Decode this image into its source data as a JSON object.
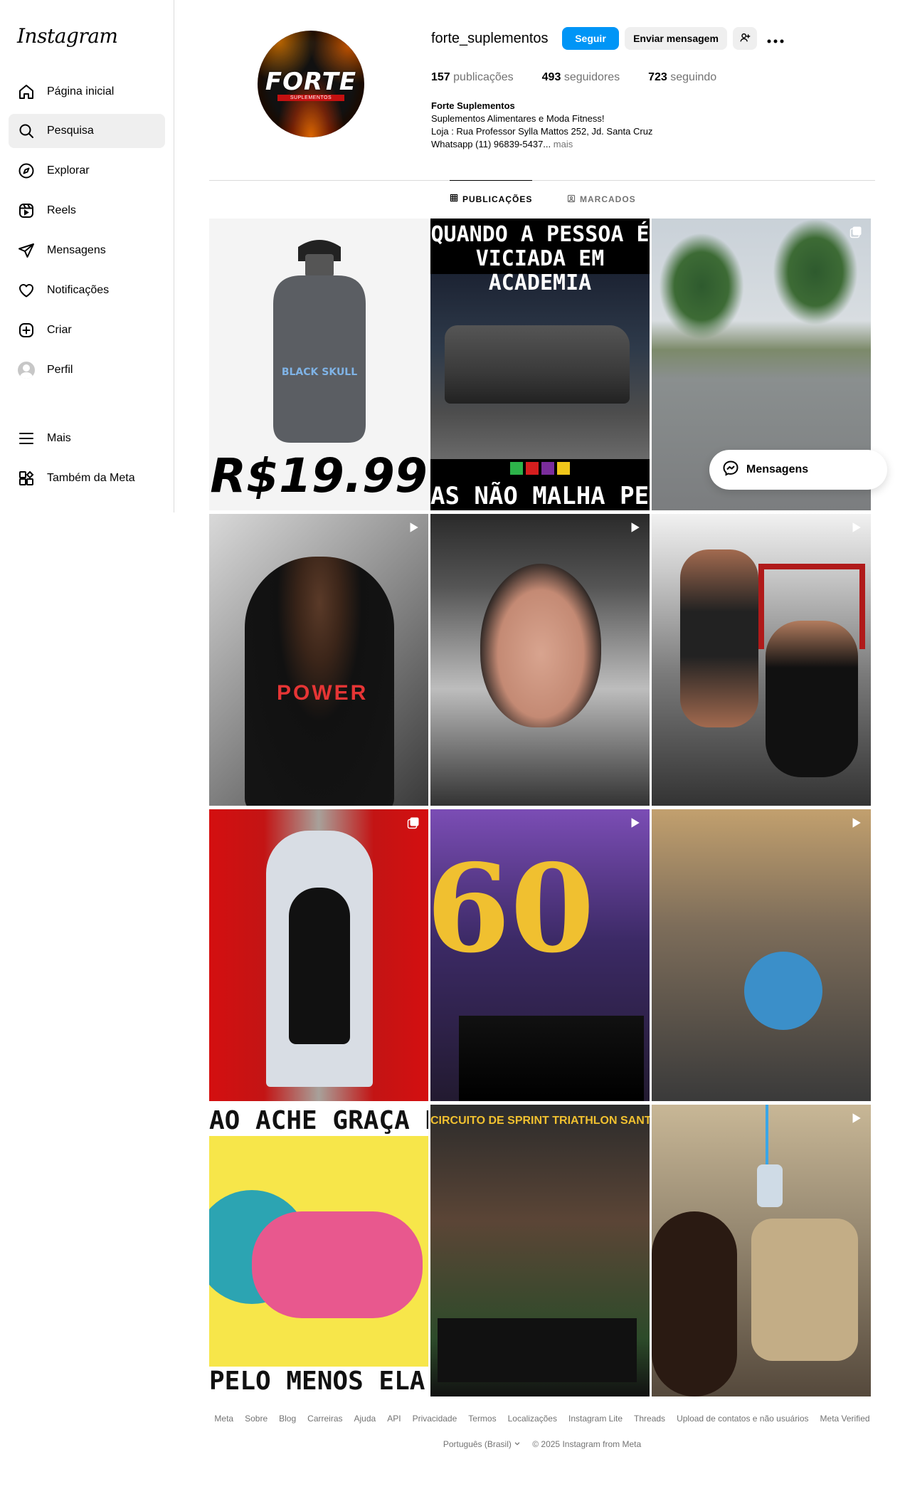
{
  "app": {
    "logo": "Instagram"
  },
  "sidebar": {
    "items": [
      {
        "label": "Página inicial",
        "icon": "home-icon"
      },
      {
        "label": "Pesquisa",
        "icon": "search-icon",
        "active": true
      },
      {
        "label": "Explorar",
        "icon": "compass-icon"
      },
      {
        "label": "Reels",
        "icon": "reels-icon"
      },
      {
        "label": "Mensagens",
        "icon": "send-icon"
      },
      {
        "label": "Notificações",
        "icon": "heart-icon"
      },
      {
        "label": "Criar",
        "icon": "plus-square-icon"
      },
      {
        "label": "Perfil",
        "icon": "avatar"
      },
      {
        "label": "Mais",
        "icon": "menu-icon"
      },
      {
        "label": "Também da Meta",
        "icon": "grid-icon"
      }
    ]
  },
  "profile": {
    "username": "forte_suplementos",
    "picture_brand": "FORTE",
    "picture_subtitle": "SUPLEMENTOS",
    "follow_label": "Seguir",
    "message_label": "Enviar mensagem",
    "stats": {
      "posts_count": "157",
      "posts_label": "publicações",
      "followers_count": "493",
      "followers_label": "seguidores",
      "following_count": "723",
      "following_label": "seguindo"
    },
    "bio": {
      "name": "Forte Suplementos",
      "line1": "Suplementos Alimentares e Moda Fitness!",
      "line2": "Loja : Rua Professor Sylla Mattos 252, Jd. Santa Cruz",
      "line3": "Whatsapp (11) 96839-5437...",
      "more": "mais"
    }
  },
  "tabs": [
    {
      "label": "PUBLICAÇÕES",
      "active": true,
      "icon": "grid-icon"
    },
    {
      "label": "MARCADOS",
      "active": false,
      "icon": "tag-icon"
    }
  ],
  "posts": {
    "p1": {
      "price": "R$19.99",
      "bottle_text": "BLACK SKULL"
    },
    "p2": {
      "top": "QUANDO A PESSOA É VICIADA EM ACADEMIA",
      "bottom": "AS NÃO MALHA PERN"
    },
    "p4": {
      "shirt_text": "POWER"
    },
    "p8": {
      "number": "60"
    },
    "p10": {
      "top": "AO ACHE GRAÇA DE UMA GORDINHA NA ACADEMIA!",
      "bottom": "PELO MENOS ELA ESTÁ LÁ QUERENDO MUDAR!"
    },
    "p11": {
      "top": "CIRCUITO DE SPRINT TRIATHLON SANT"
    }
  },
  "floating": {
    "messages_label": "Mensagens"
  },
  "footer": {
    "links": [
      "Meta",
      "Sobre",
      "Blog",
      "Carreiras",
      "Ajuda",
      "API",
      "Privacidade",
      "Termos",
      "Localizações",
      "Instagram Lite",
      "Threads",
      "Upload de contatos e não usuários",
      "Meta Verified"
    ],
    "language": "Português (Brasil)",
    "copyright": "© 2025 Instagram from Meta"
  },
  "colors": {
    "accent": "#0095f6",
    "muted": "#737373",
    "border": "#dbdbdb"
  }
}
